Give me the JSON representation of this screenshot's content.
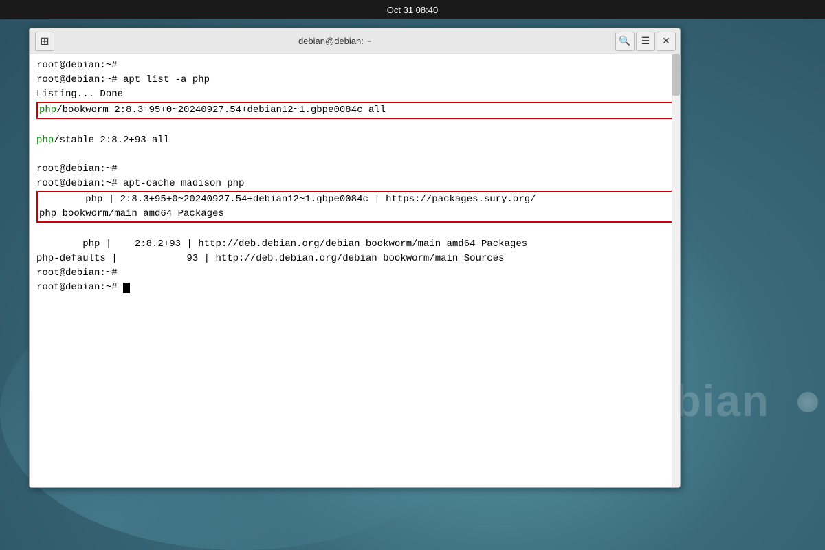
{
  "taskbar": {
    "time": "Oct 31  08:40"
  },
  "terminal": {
    "title": "debian@debian: ~",
    "lines": [
      {
        "type": "prompt",
        "text": "root@debian:~#"
      },
      {
        "type": "command",
        "text": "root@debian:~# apt list -a php"
      },
      {
        "type": "output",
        "text": "Listing... Done"
      },
      {
        "type": "highlighted_php",
        "text": "php/bookworm 2:8.3+95+0~20240927.54+debian12~1.gbpe0084c all"
      },
      {
        "type": "php_stable",
        "text": "php/stable 2:8.2+93 all"
      },
      {
        "type": "blank",
        "text": ""
      },
      {
        "type": "prompt2",
        "text": "root@debian:~#"
      },
      {
        "type": "command2",
        "text": "root@debian:~# apt-cache madison php"
      },
      {
        "type": "highlighted_madison1",
        "text": "        php | 2:8.3+95+0~20240927.54+debian12~1.gbpe0084c | https://packages.sury.org/"
      },
      {
        "type": "highlighted_madison2",
        "text": "php bookworm/main amd64 Packages"
      },
      {
        "type": "madison3",
        "text": "        php |    2:8.2+93 | http://deb.debian.org/debian bookworm/main amd64 Packages"
      },
      {
        "type": "madison4",
        "text": "php-defaults |            93 | http://deb.debian.org/debian bookworm/main Sources"
      },
      {
        "type": "prompt3",
        "text": "root@debian:~#"
      },
      {
        "type": "prompt4_cursor",
        "text": "root@debian:~# "
      }
    ]
  },
  "buttons": {
    "new_tab": "⊞",
    "search": "🔍",
    "menu": "☰",
    "close": "✕"
  },
  "watermark": "debian"
}
